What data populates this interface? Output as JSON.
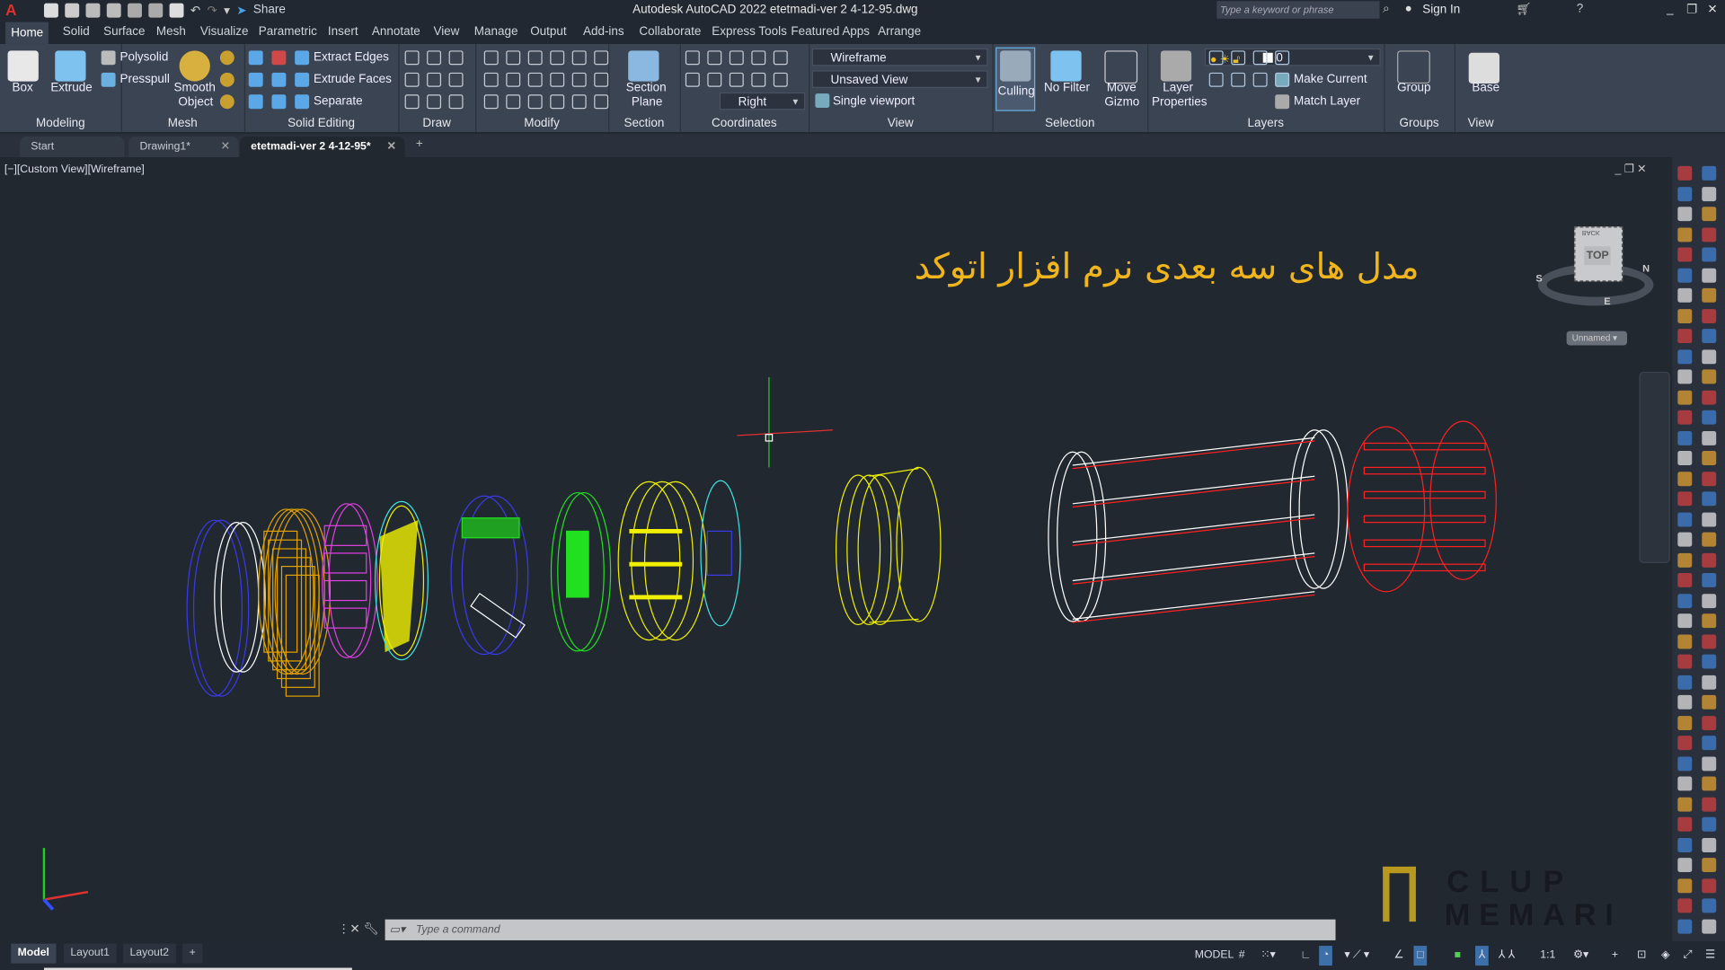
{
  "titlebar": {
    "title": "Autodesk AutoCAD 2022   etetmadi-ver 2  4-12-95.dwg",
    "share": "Share",
    "search_placeholder": "Type a keyword or phrase",
    "sign_in": "Sign In",
    "app_letter": "A"
  },
  "ribbon_tabs": [
    "Home",
    "Solid",
    "Surface",
    "Mesh",
    "Visualize",
    "Parametric",
    "Insert",
    "Annotate",
    "View",
    "Manage",
    "Output",
    "Add-ins",
    "Collaborate",
    "Express Tools",
    "Featured Apps",
    "Arrange"
  ],
  "ribbon": {
    "modeling": {
      "label": "Modeling",
      "box": "Box",
      "extrude": "Extrude",
      "polysolid": "Polysolid",
      "presspull": "Presspull"
    },
    "mesh": {
      "label": "Mesh",
      "smooth1": "Smooth",
      "smooth2": "Object"
    },
    "solid_editing": {
      "label": "Solid Editing",
      "extract_edges": "Extract Edges",
      "extrude_faces": "Extrude Faces",
      "separate": "Separate"
    },
    "draw": {
      "label": "Draw"
    },
    "modify": {
      "label": "Modify"
    },
    "section": {
      "label": "Section",
      "plane1": "Section",
      "plane2": "Plane"
    },
    "coordinates": {
      "label": "Coordinates",
      "ucs": "Right"
    },
    "view": {
      "label": "View",
      "visual_style": "Wireframe",
      "named_view": "Unsaved View",
      "viewport": "Single viewport"
    },
    "selection": {
      "label": "Selection",
      "culling": "Culling",
      "no_filter": "No Filter",
      "gizmo1": "Move",
      "gizmo2": "Gizmo"
    },
    "layers": {
      "label": "Layers",
      "props1": "Layer",
      "props2": "Properties",
      "current_layer": "0",
      "make_current": "Make Current",
      "match_layer": "Match Layer"
    },
    "groups": {
      "label": "Groups",
      "group": "Group"
    },
    "view2": {
      "label": "View",
      "base": "Base"
    }
  },
  "file_tabs": [
    {
      "label": "Start"
    },
    {
      "label": "Drawing1*"
    },
    {
      "label": "etetmadi-ver 2  4-12-95*",
      "active": true
    }
  ],
  "viewport": {
    "label": "[−][Custom View][Wireframe]",
    "annotation": "مدل های سه بعدی نرم افزار اتوکد",
    "annotation_color": "#f0b51c",
    "viewcube_face": "TOP",
    "viewcube_back": "BACK",
    "compass": [
      "S",
      "E",
      "N"
    ],
    "ucs_menu": "Unnamed",
    "wireframe_colors": [
      "#3a3ae8",
      "#ffffff",
      "#e0a000",
      "#e040e0",
      "#f0f000",
      "#40e0e0",
      "#20e020",
      "#ff2020"
    ]
  },
  "watermark": {
    "line1": "CLUP",
    "line2": "MEMARI"
  },
  "command_line": {
    "placeholder": "Type a command"
  },
  "layout_tabs": [
    "Model",
    "Layout1",
    "Layout2"
  ],
  "status": {
    "model": "MODEL",
    "scale": "1:1"
  }
}
